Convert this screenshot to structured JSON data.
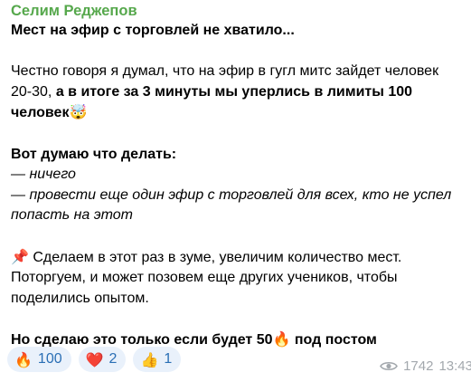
{
  "post": {
    "author": "Селим Реджепов",
    "headline": "Мест на эфир с торговлей не хватило...",
    "para1_normal": "Честно говоря я думал, что на эфир в гугл митс зайдет человек 20-30, ",
    "para1_bold": "а в итоге за 3 минуты мы уперлись в лимиты 100 человек",
    "para1_emoji": "🤯",
    "list_heading": "Вот думаю что делать:",
    "option1": "— ничего",
    "option2": "— провести еще один эфир с торговлей для всех, кто не успел попасть на этот",
    "pin_emoji": "📌",
    "para3": "Сделаем в этот раз в зуме, увеличим количество мест. Поторгуем, и может позовем еще других учеников, чтобы поделились опытом.",
    "final_bold_1": "Но сделаю это только если будет 50",
    "final_emoji": "🔥",
    "final_bold_2": " под постом"
  },
  "reactions": [
    {
      "emoji": "🔥",
      "icon": "fire-icon",
      "count": "100"
    },
    {
      "emoji": "❤️",
      "icon": "heart-icon",
      "count": "2"
    },
    {
      "emoji": "👍",
      "icon": "thumbs-up-icon",
      "count": "1"
    }
  ],
  "meta": {
    "views": "1742",
    "time": "13:43",
    "icon": "eye-icon"
  },
  "colors": {
    "author": "#56a84c",
    "reaction_bg": "#e9f1fb",
    "reaction_text": "#2a6fb5",
    "meta_text": "#a3a8ad"
  }
}
